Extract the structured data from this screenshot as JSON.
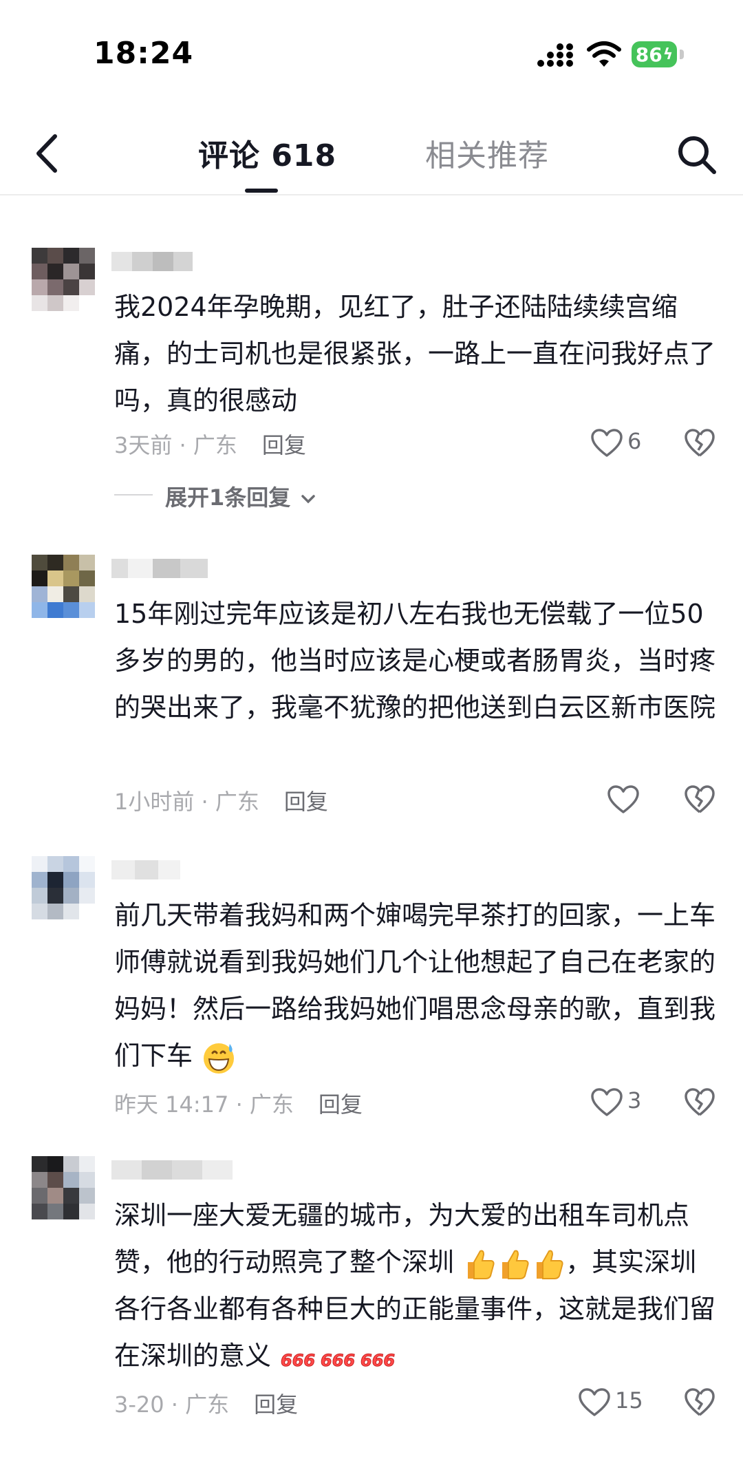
{
  "status_bar": {
    "time": "18:24",
    "battery": "86"
  },
  "header": {
    "tab_comments": "评论 618",
    "tab_related": "相关推荐"
  },
  "comments": [
    {
      "text": "我2024年孕晚期，见红了，肚子还陆陆续续宫缩痛，的士司机也是很紧张，一路上一直在问我好点了吗，真的很感动",
      "time_location": "3天前 · 广东",
      "reply_label": "回复",
      "likes": "6",
      "expand": "展开1条回复"
    },
    {
      "text": "15年刚过完年应该是初八左右我也无偿载了一位50多岁的男的，他当时应该是心梗或者肠胃炎，当时疼的哭出来了，我毫不犹豫的把他送到白云区新市医院",
      "time_location": "1小时前 · 广东",
      "reply_label": "回复",
      "likes": ""
    },
    {
      "text": "前几天带着我妈和两个婶喝完早茶打的回家，一上车师傅就说看到我妈她们几个让他想起了自己在老家的妈妈！然后一路给我妈她们唱思念母亲的歌，直到我们下车",
      "time_location": "昨天 14:17 · 广东",
      "reply_label": "回复",
      "likes": "3"
    },
    {
      "text1": "深圳一座大爱无疆的城市，为大爱的出租车司机点赞，他的行动照亮了整个深圳",
      "text2": "，其实深圳各行各业都有各种巨大的正能量事件，这就是我们留在深圳的意义",
      "time_location": "3-20 · 广东",
      "reply_label": "回复",
      "likes": "15"
    }
  ],
  "icons": [
    "back-arrow",
    "search",
    "heart",
    "broken-heart",
    "grinning-sweat-emoji",
    "thumbs-up-emoji",
    "666-emoji"
  ]
}
